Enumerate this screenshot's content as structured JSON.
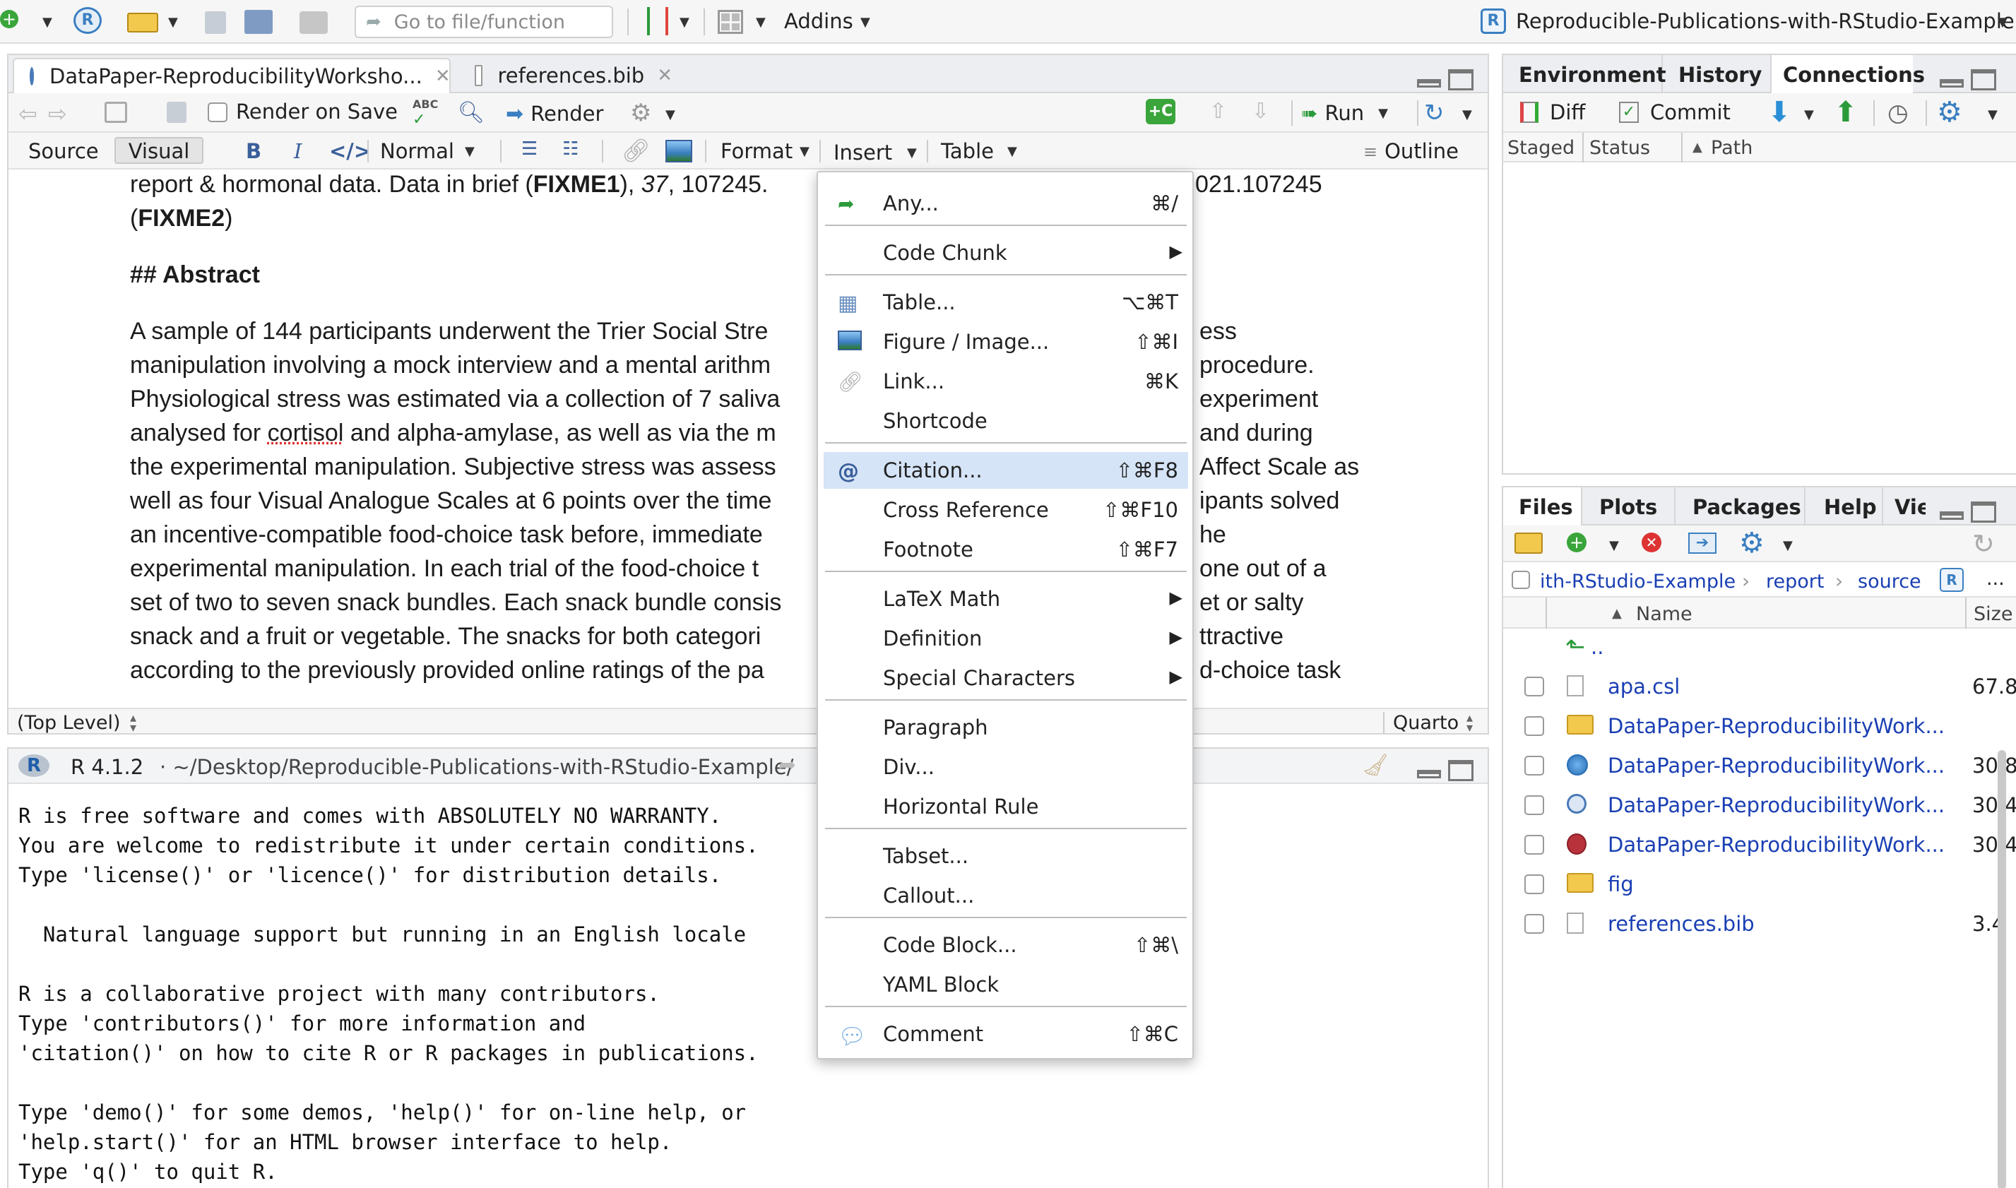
{
  "toolbar": {
    "goto_placeholder": "Go to file/function",
    "addins": "Addins",
    "project": "Reproducible-Publications-with-RStudio-Example"
  },
  "editor": {
    "tabs": [
      {
        "label": "DataPaper-ReproducibilityWorksho..."
      },
      {
        "label": "references.bib"
      }
    ],
    "render_on_save": "Render on Save",
    "render": "Render",
    "run": "Run",
    "source": "Source",
    "visual": "Visual",
    "bold": "B",
    "italic": "I",
    "style": "Normal",
    "format": "Format",
    "insert": "Insert",
    "table": "Table",
    "outline": "Outline",
    "status_left": "(Top Level)",
    "status_right": "Quarto",
    "line1": {
      "a": "report & hormonal data. Data in brief (",
      "b": "FIXME1",
      "c": "), ",
      "d": "37",
      "e": ", 107245.",
      "f": "021.107245"
    },
    "line2": {
      "a": "(",
      "b": "FIXME2",
      "c": ")"
    },
    "heading": "## Abstract",
    "para": [
      {
        "a": "A sample of 144 participants underwent the Trier Social Stre",
        "b": "ess"
      },
      {
        "a": "manipulation involving a mock interview and a mental arithm",
        "b": "procedure."
      },
      {
        "a": "Physiological stress was estimated via a collection of 7 saliva",
        "b": "experiment"
      },
      {
        "a": "analysed for cortisol and alpha-amylase, as well as via the m",
        "b": "and during"
      },
      {
        "a": "the experimental manipulation. Subjective stress was assess",
        "b": "Affect Scale as"
      },
      {
        "a": "well as four Visual Analogue Scales at 6 points over the time",
        "b": "ipants solved"
      },
      {
        "a": "an incentive-compatible food-choice task before, immediate",
        "b": "he"
      },
      {
        "a": "experimental manipulation. In each trial of the food-choice t",
        "b": "one out of a"
      },
      {
        "a": "set of two to seven snack bundles. Each snack bundle consis",
        "b": "et or salty"
      },
      {
        "a": "snack and a fruit or vegetable. The snacks for both categori",
        "b": "ttractive"
      },
      {
        "a": "according to the previously provided online ratings of the pa",
        "b": "d-choice task"
      }
    ]
  },
  "console": {
    "version": "R 4.1.2",
    "path": "· ~/Desktop/Reproducible-Publications-with-RStudio-Example/",
    "lines": [
      "R is free software and comes with ABSOLUTELY NO WARRANTY.",
      "You are welcome to redistribute it under certain conditions.",
      "Type 'license()' or 'licence()' for distribution details.",
      "",
      "  Natural language support but running in an English locale",
      "",
      "R is a collaborative project with many contributors.",
      "Type 'contributors()' for more information and",
      "'citation()' on how to cite R or R packages in publications.",
      "",
      "Type 'demo()' for some demos, 'help()' for on-line help, or",
      "'help.start()' for an HTML browser interface to help.",
      "Type 'q()' to quit R."
    ]
  },
  "insert_menu": {
    "items": [
      {
        "label": "Any...",
        "shortcut": "⌘/"
      },
      {
        "label": "Code Chunk"
      },
      {
        "label": "Table...",
        "shortcut": "⌥⌘T"
      },
      {
        "label": "Figure / Image...",
        "shortcut": "⇧⌘I"
      },
      {
        "label": "Link...",
        "shortcut": "⌘K"
      },
      {
        "label": "Shortcode"
      },
      {
        "label": "Citation...",
        "shortcut": "⇧⌘F8"
      },
      {
        "label": "Cross Reference",
        "shortcut": "⇧⌘F10"
      },
      {
        "label": "Footnote",
        "shortcut": "⇧⌘F7"
      },
      {
        "label": "LaTeX Math"
      },
      {
        "label": "Definition"
      },
      {
        "label": "Special Characters"
      },
      {
        "label": "Paragraph"
      },
      {
        "label": "Div..."
      },
      {
        "label": "Horizontal Rule"
      },
      {
        "label": "Tabset..."
      },
      {
        "label": "Callout..."
      },
      {
        "label": "Code Block...",
        "shortcut": "⇧⌘\\"
      },
      {
        "label": "YAML Block"
      },
      {
        "label": "Comment",
        "shortcut": "⇧⌘C"
      }
    ]
  },
  "env_pane": {
    "tabs": [
      "Environment",
      "History",
      "Connections"
    ],
    "diff": "Diff",
    "commit": "Commit",
    "cols": {
      "staged": "Staged",
      "status": "Status",
      "path": "Path"
    }
  },
  "files_pane": {
    "tabs": [
      "Files",
      "Plots",
      "Packages",
      "Help",
      "View"
    ],
    "breadcrumb": [
      "ith-RStudio-Example",
      "report",
      "source"
    ],
    "more": "...",
    "col_name": "Name",
    "col_size": "Size",
    "up": "..",
    "files": [
      {
        "name": "apa.csl",
        "size": "67.8"
      },
      {
        "name": "DataPaper-ReproducibilityWork...",
        "size": ""
      },
      {
        "name": "DataPaper-ReproducibilityWork...",
        "size": "30.8"
      },
      {
        "name": "DataPaper-ReproducibilityWork...",
        "size": "30.4"
      },
      {
        "name": "DataPaper-ReproducibilityWork...",
        "size": "30.4"
      },
      {
        "name": "fig",
        "size": ""
      },
      {
        "name": "references.bib",
        "size": "3.4"
      }
    ]
  }
}
